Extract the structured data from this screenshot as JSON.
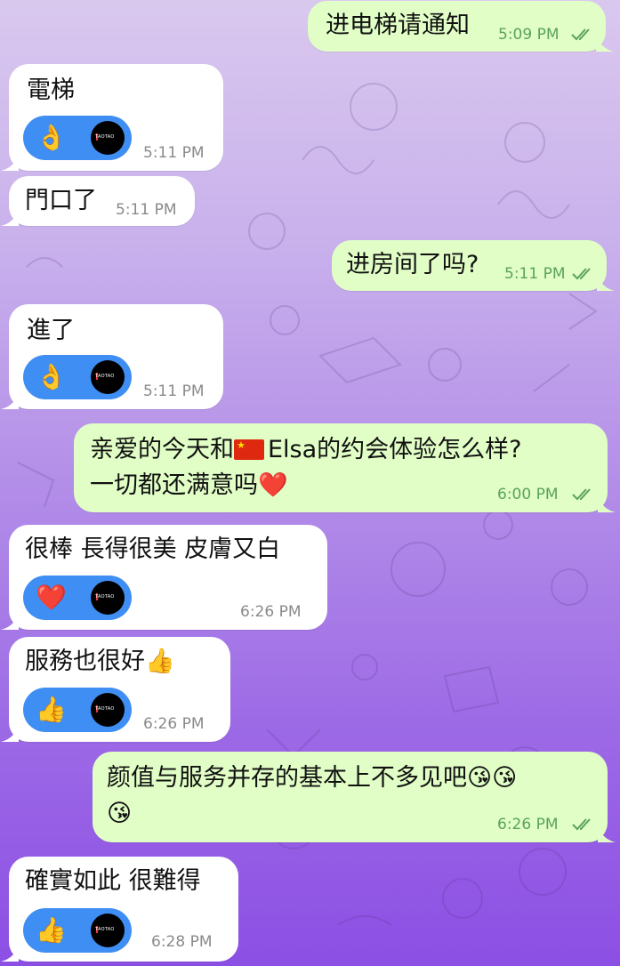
{
  "messages": [
    {
      "dir": "out",
      "text": "进电梯请通知",
      "time": "5:09 PM"
    },
    {
      "dir": "in",
      "text": "電梯",
      "time": "5:11 PM",
      "reaction": "👌"
    },
    {
      "dir": "in",
      "text": "門口了",
      "time": "5:11 PM"
    },
    {
      "dir": "out",
      "text": "进房间了吗?",
      "time": "5:11 PM"
    },
    {
      "dir": "in",
      "text": "進了",
      "time": "5:11 PM",
      "reaction": "👌"
    },
    {
      "dir": "out",
      "line1_pre": "亲爱的今天和",
      "line1_post": "Elsa的约会体验怎么样?",
      "line2": "一切都还满意吗",
      "line2_emoji": "❤️",
      "time": "6:00 PM"
    },
    {
      "dir": "in",
      "text": "很棒 長得很美 皮膚又白",
      "time": "6:26 PM",
      "reaction": "❤️"
    },
    {
      "dir": "in",
      "text": "服務也很好👍",
      "time": "6:26 PM",
      "reaction": "👍"
    },
    {
      "dir": "out",
      "line1": "颜值与服务并存的基本上不多见吧😘😘",
      "line2": "😘",
      "time": "6:26 PM"
    },
    {
      "dir": "in",
      "text": "確實如此 很難得",
      "time": "6:28 PM",
      "reaction": "👍"
    }
  ],
  "avatar_label": "TAOTAO",
  "colors": {
    "incoming": "#ffffff",
    "outgoing": "#e1fec6",
    "reaction": "#3f8ef3",
    "read_check": "#5aa35a"
  }
}
